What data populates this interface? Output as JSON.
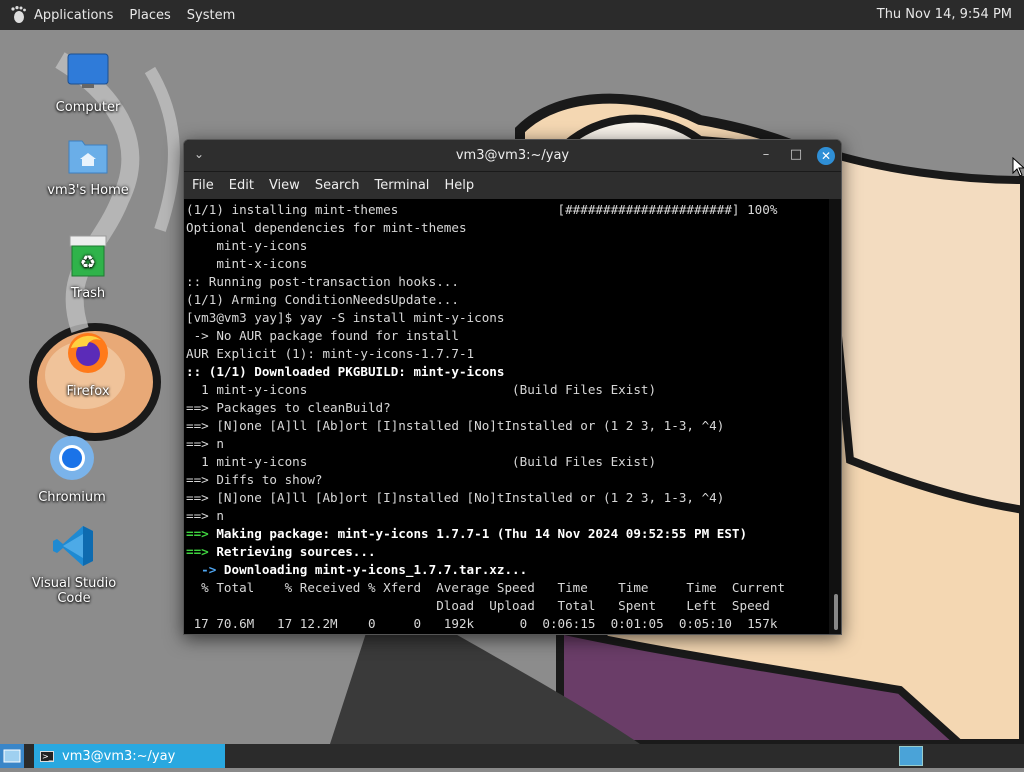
{
  "top_panel": {
    "menu": [
      "Applications",
      "Places",
      "System"
    ],
    "clock": "Thu Nov 14,  9:54 PM"
  },
  "desktop_icons": [
    {
      "label": "Computer",
      "icon": "computer-icon"
    },
    {
      "label": "vm3's Home",
      "icon": "home-folder-icon"
    },
    {
      "label": "Trash",
      "icon": "trash-icon"
    },
    {
      "label": "Firefox",
      "icon": "firefox-icon"
    },
    {
      "label": "Chromium",
      "icon": "chromium-icon"
    },
    {
      "label": "Visual Studio Code",
      "icon": "vscode-icon"
    }
  ],
  "terminal": {
    "title": "vm3@vm3:~/yay",
    "menu": [
      "File",
      "Edit",
      "View",
      "Search",
      "Terminal",
      "Help"
    ],
    "lines": [
      {
        "style": "normal",
        "text": "(1/1) installing mint-themes                     [######################] 100%"
      },
      {
        "style": "normal",
        "text": "Optional dependencies for mint-themes"
      },
      {
        "style": "normal",
        "text": "    mint-y-icons"
      },
      {
        "style": "normal",
        "text": "    mint-x-icons"
      },
      {
        "style": "normal",
        "text": ":: Running post-transaction hooks..."
      },
      {
        "style": "normal",
        "text": "(1/1) Arming ConditionNeedsUpdate..."
      },
      {
        "style": "normal",
        "text": "[vm3@vm3 yay]$ yay -S install mint-y-icons"
      },
      {
        "style": "normal",
        "text": " -> No AUR package found for install"
      },
      {
        "style": "normal",
        "text": "AUR Explicit (1): mint-y-icons-1.7.7-1"
      },
      {
        "style": "bold",
        "text": ":: (1/1) Downloaded PKGBUILD: mint-y-icons"
      },
      {
        "style": "normal",
        "text": "  1 mint-y-icons                           (Build Files Exist)"
      },
      {
        "style": "normal",
        "text": "==> Packages to cleanBuild?"
      },
      {
        "style": "normal",
        "text": "==> [N]one [A]ll [Ab]ort [I]nstalled [No]tInstalled or (1 2 3, 1-3, ^4)"
      },
      {
        "style": "normal",
        "text": "==> n"
      },
      {
        "style": "normal",
        "text": "  1 mint-y-icons                           (Build Files Exist)"
      },
      {
        "style": "normal",
        "text": "==> Diffs to show?"
      },
      {
        "style": "normal",
        "text": "==> [N]one [A]ll [Ab]ort [I]nstalled [No]tInstalled or (1 2 3, 1-3, ^4)"
      },
      {
        "style": "normal",
        "text": "==> n"
      },
      {
        "style": "green-bold",
        "prefix": "==>",
        "text": " Making package: mint-y-icons 1.7.7-1 (Thu 14 Nov 2024 09:52:55 PM EST)"
      },
      {
        "style": "green-bold",
        "prefix": "==>",
        "text": " Retrieving sources..."
      },
      {
        "style": "blue-bold",
        "prefix": "  ->",
        "text": " Downloading mint-y-icons_1.7.7.tar.xz..."
      },
      {
        "style": "normal",
        "text": "  % Total    % Received % Xferd  Average Speed   Time    Time     Time  Current"
      },
      {
        "style": "normal",
        "text": "                                 Dload  Upload   Total   Spent    Left  Speed"
      },
      {
        "style": "normal",
        "text": " 17 70.6M   17 12.2M    0     0   192k      0  0:06:15  0:01:05  0:05:10  157k"
      }
    ]
  },
  "taskbar": {
    "task_label": "vm3@vm3:~/yay"
  },
  "colors": {
    "panel": "#2b2b2b",
    "accent": "#29a8e0",
    "close_button": "#2f8fd6",
    "prompt_green": "#3fd33f",
    "arrow_blue": "#4fa6f2"
  }
}
